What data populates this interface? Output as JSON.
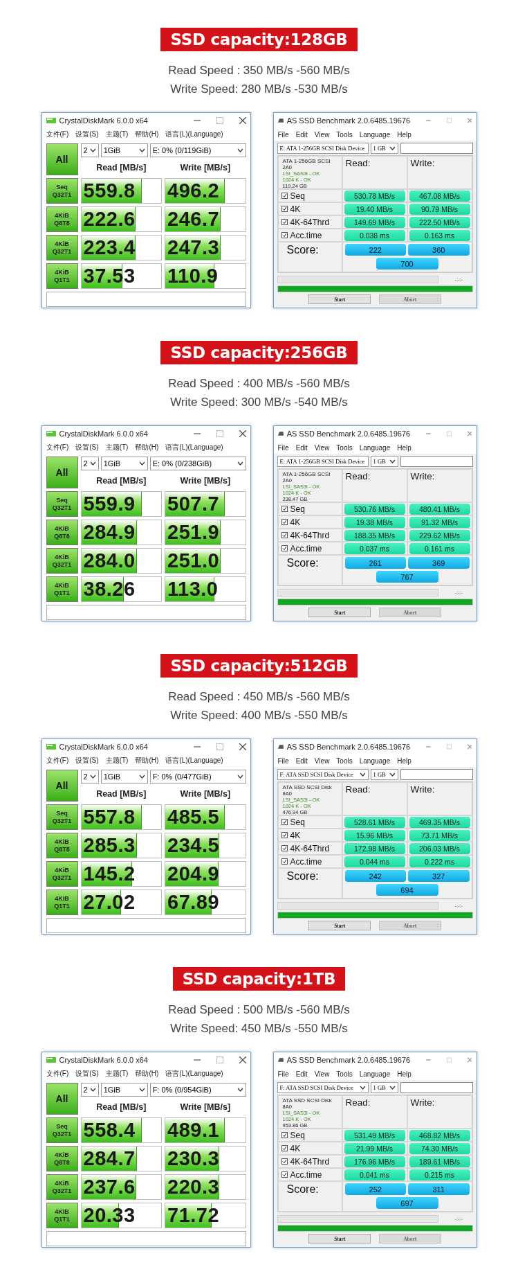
{
  "sections": [
    {
      "title": "SSD capacity:128GB",
      "read_speed": "Read Speed : 350 MB/s -560 MB/s",
      "write_speed": "Write Speed: 280 MB/s -530 MB/s",
      "crystaldiskmark": {
        "title": "CrystalDiskMark 6.0.0 x64",
        "menu": [
          "文件(F)",
          "设置(S)",
          "主题(T)",
          "帮助(H)",
          "语言(L)(Language)"
        ],
        "all_button": "All",
        "count": "2",
        "size": "1GiB",
        "drive": "E: 0% (0/119GiB)",
        "read_header": "Read [MB/s]",
        "write_header": "Write [MB/s]",
        "rows": [
          {
            "label": "Seq Q32T1",
            "read": {
              "value": "559.8",
              "level": 0.75
            },
            "write": {
              "value": "496.2",
              "level": 0.74
            }
          },
          {
            "label": "4KiB Q8T8",
            "read": {
              "value": "222.6",
              "level": 0.67
            },
            "write": {
              "value": "246.7",
              "level": 0.68
            }
          },
          {
            "label": "4KiB Q32T1",
            "read": {
              "value": "223.4",
              "level": 0.67
            },
            "write": {
              "value": "247.3",
              "level": 0.68
            }
          },
          {
            "label": "4KiB Q1T1",
            "read": {
              "value": "37.53",
              "level": 0.51
            },
            "write": {
              "value": "110.9",
              "level": 0.61
            }
          }
        ]
      },
      "as_ssd": {
        "title": "AS SSD Benchmark 2.0.6485.19676",
        "menu": [
          "File",
          "Edit",
          "View",
          "Tools",
          "Language",
          "Help"
        ],
        "device": "E: ATA 1-256GB SCSI Disk Device",
        "size": "1 GB",
        "info": {
          "name": "ATA 1-256GB SCSI",
          "firmware": "2A0",
          "driver": "LSI_SAS3i - OK",
          "alignment": "1024 K - OK",
          "capacity": "119.24 GB"
        },
        "read_header": "Read:",
        "write_header": "Write:",
        "rows": [
          {
            "label": "Seq",
            "checked": true,
            "read": "530.78 MB/s",
            "write": "467.08 MB/s"
          },
          {
            "label": "4K",
            "checked": true,
            "read": "19.40 MB/s",
            "write": "90.79 MB/s"
          },
          {
            "label": "4K-64Thrd",
            "checked": true,
            "read": "149.69 MB/s",
            "write": "222.50 MB/s"
          },
          {
            "label": "Acc.time",
            "checked": true,
            "read": "0.038 ms",
            "write": "0.163 ms"
          }
        ],
        "score_label": "Score:",
        "score_read": "222",
        "score_write": "360",
        "score_total": "700",
        "time": "-:-:-",
        "progress": {
          "level": 1
        },
        "buttons": [
          {
            "label": "Start",
            "disabled": false
          },
          {
            "label": "Abort",
            "disabled": true
          }
        ]
      }
    },
    {
      "title": "SSD capacity:256GB",
      "read_speed": "Read Speed : 400 MB/s -560 MB/s",
      "write_speed": "Write Speed: 300 MB/s -540 MB/s",
      "crystaldiskmark": {
        "title": "CrystalDiskMark 6.0.0 x64",
        "menu": [
          "文件(F)",
          "设置(S)",
          "主题(T)",
          "帮助(H)",
          "语言(L)(Language)"
        ],
        "all_button": "All",
        "count": "2",
        "size": "1GiB",
        "drive": "E: 0% (0/238GiB)",
        "read_header": "Read [MB/s]",
        "write_header": "Write [MB/s]",
        "rows": [
          {
            "label": "Seq Q32T1",
            "read": {
              "value": "559.9",
              "level": 0.75
            },
            "write": {
              "value": "507.7",
              "level": 0.74
            }
          },
          {
            "label": "4KiB Q8T8",
            "read": {
              "value": "284.9",
              "level": 0.69
            },
            "write": {
              "value": "251.9",
              "level": 0.68
            }
          },
          {
            "label": "4KiB Q32T1",
            "read": {
              "value": "284.0",
              "level": 0.69
            },
            "write": {
              "value": "251.0",
              "level": 0.68
            }
          },
          {
            "label": "4KiB Q1T1",
            "read": {
              "value": "38.26",
              "level": 0.52
            },
            "write": {
              "value": "113.0",
              "level": 0.61
            }
          }
        ]
      },
      "as_ssd": {
        "title": "AS SSD Benchmark 2.0.6485.19676",
        "menu": [
          "File",
          "Edit",
          "View",
          "Tools",
          "Language",
          "Help"
        ],
        "device": "E: ATA 1-256GB SCSI Disk Device",
        "size": "1 GB",
        "info": {
          "name": "ATA 1-256GB SCSI",
          "firmware": "2A0",
          "driver": "LSI_SAS3i - OK",
          "alignment": "1024 K - OK",
          "capacity": "238.47 GB"
        },
        "read_header": "Read:",
        "write_header": "Write:",
        "rows": [
          {
            "label": "Seq",
            "checked": true,
            "read": "530.76 MB/s",
            "write": "480.41 MB/s"
          },
          {
            "label": "4K",
            "checked": true,
            "read": "19.38 MB/s",
            "write": "91.32 MB/s"
          },
          {
            "label": "4K-64Thrd",
            "checked": true,
            "read": "188.35 MB/s",
            "write": "229.62 MB/s"
          },
          {
            "label": "Acc.time",
            "checked": true,
            "read": "0.037 ms",
            "write": "0.161 ms"
          }
        ],
        "score_label": "Score:",
        "score_read": "261",
        "score_write": "369",
        "score_total": "767",
        "time": "-:-:-",
        "progress": {
          "level": 1
        },
        "buttons": [
          {
            "label": "Start",
            "disabled": false
          },
          {
            "label": "Abort",
            "disabled": true
          }
        ]
      }
    },
    {
      "title": "SSD capacity:512GB",
      "read_speed": "Read Speed : 450 MB/s -560 MB/s",
      "write_speed": "Write Speed: 400 MB/s -550 MB/s",
      "crystaldiskmark": {
        "title": "CrystalDiskMark 6.0.0 x64",
        "menu": [
          "文件(F)",
          "设置(S)",
          "主题(T)",
          "帮助(H)",
          "语言(L)(Language)"
        ],
        "all_button": "All",
        "count": "2",
        "size": "1GiB",
        "drive": "F: 0% (0/477GiB)",
        "read_header": "Read [MB/s]",
        "write_header": "Write [MB/s]",
        "rows": [
          {
            "label": "Seq Q32T1",
            "read": {
              "value": "557.8",
              "level": 0.75
            },
            "write": {
              "value": "485.5",
              "level": 0.74
            }
          },
          {
            "label": "4KiB Q8T8",
            "read": {
              "value": "285.3",
              "level": 0.69
            },
            "write": {
              "value": "234.5",
              "level": 0.67
            }
          },
          {
            "label": "4KiB Q32T1",
            "read": {
              "value": "145.2",
              "level": 0.63
            },
            "write": {
              "value": "204.9",
              "level": 0.66
            }
          },
          {
            "label": "4KiB Q1T1",
            "read": {
              "value": "27.02",
              "level": 0.49
            },
            "write": {
              "value": "67.89",
              "level": 0.57
            }
          }
        ]
      },
      "as_ssd": {
        "title": "AS SSD Benchmark 2.0.6485.19676",
        "menu": [
          "File",
          "Edit",
          "View",
          "Tools",
          "Language",
          "Help"
        ],
        "device": "F: ATA SSD SCSI Disk Device",
        "size": "1 GB",
        "info": {
          "name": "ATA SSD SCSI Disk",
          "firmware": "8A0",
          "driver": "LSI_SAS3i - OK",
          "alignment": "1024 K - OK",
          "capacity": "476.94 GB"
        },
        "read_header": "Read:",
        "write_header": "Write:",
        "rows": [
          {
            "label": "Seq",
            "checked": true,
            "read": "528.61 MB/s",
            "write": "469.35 MB/s"
          },
          {
            "label": "4K",
            "checked": true,
            "read": "15.96 MB/s",
            "write": "73.71 MB/s"
          },
          {
            "label": "4K-64Thrd",
            "checked": true,
            "read": "172.98 MB/s",
            "write": "206.03 MB/s"
          },
          {
            "label": "Acc.time",
            "checked": true,
            "read": "0.044 ms",
            "write": "0.222 ms"
          }
        ],
        "score_label": "Score:",
        "score_read": "242",
        "score_write": "327",
        "score_total": "694",
        "time": "-:-:-",
        "progress": {
          "level": 1
        },
        "buttons": [
          {
            "label": "Start",
            "disabled": false
          },
          {
            "label": "Abort",
            "disabled": true
          }
        ]
      }
    },
    {
      "title": "SSD capacity:1TB",
      "read_speed": "Read Speed : 500 MB/s -560 MB/s",
      "write_speed": "Write Speed: 450 MB/s -550 MB/s",
      "crystaldiskmark": {
        "title": "CrystalDiskMark 6.0.0 x64",
        "menu": [
          "文件(F)",
          "设置(S)",
          "主题(T)",
          "帮助(H)",
          "语言(L)(Language)"
        ],
        "all_button": "All",
        "count": "2",
        "size": "1GiB",
        "drive": "F: 0% (0/954GiB)",
        "read_header": "Read [MB/s]",
        "write_header": "Write [MB/s]",
        "rows": [
          {
            "label": "Seq Q32T1",
            "read": {
              "value": "558.4",
              "level": 0.75
            },
            "write": {
              "value": "489.1",
              "level": 0.74
            }
          },
          {
            "label": "4KiB Q8T8",
            "read": {
              "value": "284.7",
              "level": 0.69
            },
            "write": {
              "value": "230.3",
              "level": 0.67
            }
          },
          {
            "label": "4KiB Q32T1",
            "read": {
              "value": "237.6",
              "level": 0.68
            },
            "write": {
              "value": "220.3",
              "level": 0.67
            }
          },
          {
            "label": "4KiB Q1T1",
            "read": {
              "value": "20.33",
              "level": 0.46
            },
            "write": {
              "value": "71.72",
              "level": 0.57
            }
          }
        ]
      },
      "as_ssd": {
        "title": "AS SSD Benchmark 2.0.6485.19676",
        "menu": [
          "File",
          "Edit",
          "View",
          "Tools",
          "Language",
          "Help"
        ],
        "device": "F: ATA SSD SCSI Disk Device",
        "size": "1 GB",
        "info": {
          "name": "ATA SSD SCSI Disk",
          "firmware": "8A0",
          "driver": "LSI_SAS3i - OK",
          "alignment": "1024 K - OK",
          "capacity": "953.86 GB"
        },
        "read_header": "Read:",
        "write_header": "Write:",
        "rows": [
          {
            "label": "Seq",
            "checked": true,
            "read": "531.49 MB/s",
            "write": "468.82 MB/s"
          },
          {
            "label": "4K",
            "checked": true,
            "read": "21.99 MB/s",
            "write": "74.30 MB/s"
          },
          {
            "label": "4K-64Thrd",
            "checked": true,
            "read": "176.96 MB/s",
            "write": "189.61 MB/s"
          },
          {
            "label": "Acc.time",
            "checked": true,
            "read": "0.041 ms",
            "write": "0.215 ms"
          }
        ],
        "score_label": "Score:",
        "score_read": "252",
        "score_write": "311",
        "score_total": "697",
        "time": "-:-:-",
        "progress": {
          "level": 1
        },
        "buttons": [
          {
            "label": "Start",
            "disabled": false
          },
          {
            "label": "Abort",
            "disabled": true
          }
        ]
      }
    }
  ]
}
